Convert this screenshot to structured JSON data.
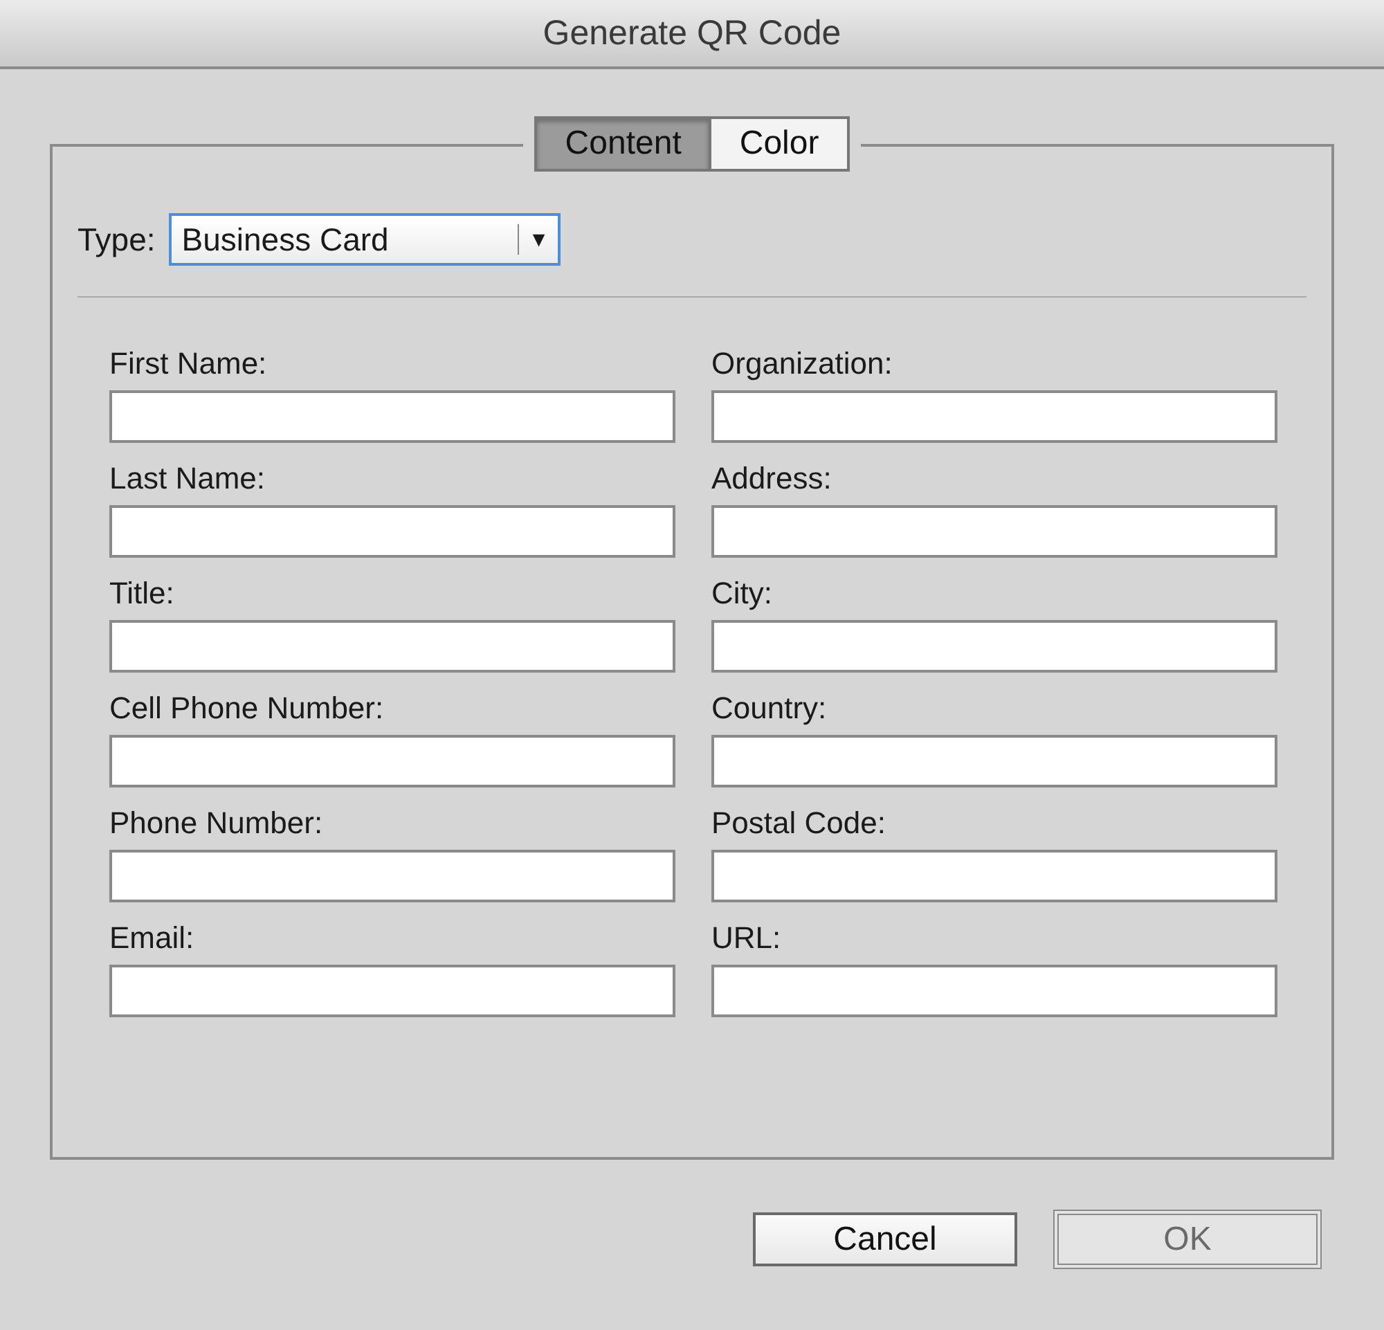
{
  "window": {
    "title": "Generate QR Code"
  },
  "tabs": [
    {
      "label": "Content",
      "selected": true
    },
    {
      "label": "Color",
      "selected": false
    }
  ],
  "type_field": {
    "label": "Type:",
    "value": "Business Card",
    "arrow": "▼"
  },
  "fields": [
    {
      "label": "First Name:"
    },
    {
      "label": "Organization:"
    },
    {
      "label": "Last Name:"
    },
    {
      "label": "Address:"
    },
    {
      "label": "Title:"
    },
    {
      "label": "City:"
    },
    {
      "label": "Cell Phone Number:"
    },
    {
      "label": "Country:"
    },
    {
      "label": "Phone Number:"
    },
    {
      "label": "Postal Code:"
    },
    {
      "label": "Email:"
    },
    {
      "label": "URL:"
    }
  ],
  "buttons": [
    {
      "label": "Cancel",
      "disabled": false
    },
    {
      "label": "OK",
      "disabled": true
    }
  ]
}
